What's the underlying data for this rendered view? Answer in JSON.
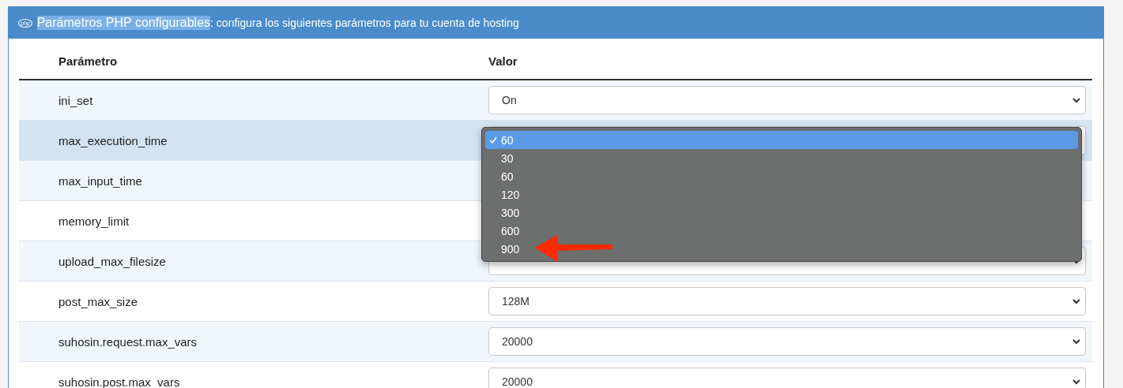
{
  "panel": {
    "badge": "php",
    "title": "Parámetros PHP configurables",
    "title_highlighted": true,
    "subtitle": ": configura los siguientes parámetros para tu cuenta de hosting"
  },
  "table": {
    "columns": [
      "Parámetro",
      "Valor"
    ],
    "rows": [
      {
        "name": "ini_set",
        "value": "On",
        "hovered": false,
        "covered": false
      },
      {
        "name": "max_execution_time",
        "hovered": true,
        "open": true,
        "covered": false
      },
      {
        "name": "max_input_time",
        "hovered": false,
        "covered": true
      },
      {
        "name": "memory_limit",
        "hovered": false,
        "covered": true
      },
      {
        "name": "upload_max_filesize",
        "hovered": false,
        "covered": false
      },
      {
        "name": "post_max_size",
        "value": "128M",
        "hovered": false,
        "covered": false
      },
      {
        "name": "suhosin.request.max_vars",
        "value": "20000",
        "hovered": false,
        "covered": false
      },
      {
        "name": "suhosin.post.max_vars",
        "value": "20000",
        "hovered": false,
        "covered": false
      }
    ]
  },
  "dropdown": {
    "options": [
      {
        "label": "60",
        "selected": true
      },
      {
        "label": "30",
        "selected": false
      },
      {
        "label": "60",
        "selected": false
      },
      {
        "label": "120",
        "selected": false
      },
      {
        "label": "300",
        "selected": false
      },
      {
        "label": "600",
        "selected": false
      },
      {
        "label": "900",
        "selected": false,
        "annotated": true
      }
    ]
  }
}
